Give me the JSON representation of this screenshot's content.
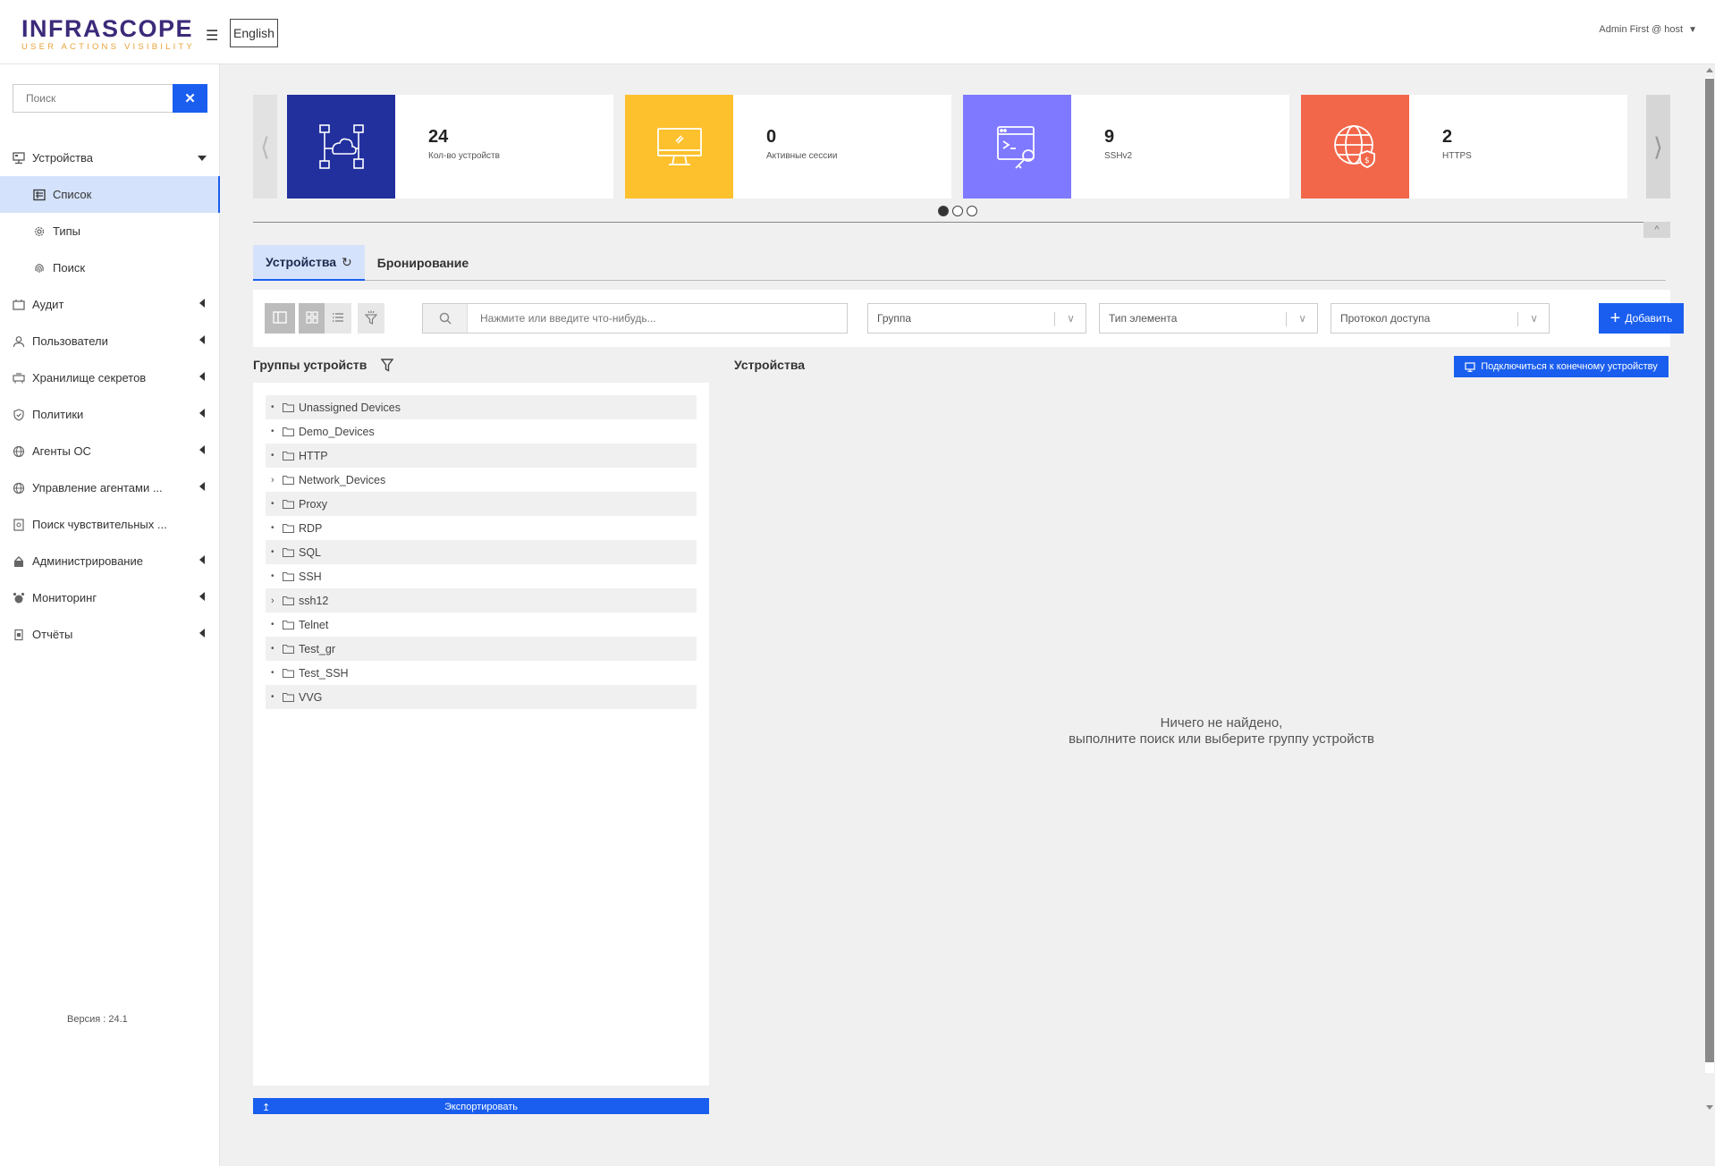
{
  "header": {
    "logo_main": "INFRASCOPE",
    "logo_sub": "USER ACTIONS VISIBILITY",
    "language": "English",
    "user": "Admin First @ host",
    "menu_icon": "hamburger-icon"
  },
  "sidebar": {
    "search_placeholder": "Поиск",
    "clear_icon": "close-icon",
    "items": [
      {
        "label": "Устройства",
        "icon": "devices-icon",
        "expanded": true
      },
      {
        "label": "Список",
        "icon": "list-icon",
        "active": true
      },
      {
        "label": "Типы",
        "icon": "gear-icon"
      },
      {
        "label": "Поиск",
        "icon": "fingerprint-icon"
      },
      {
        "label": "Аудит",
        "icon": "audit-icon"
      },
      {
        "label": "Пользователи",
        "icon": "user-icon"
      },
      {
        "label": "Хранилище секретов",
        "icon": "vault-icon"
      },
      {
        "label": "Политики",
        "icon": "shield-icon"
      },
      {
        "label": "Агенты ОС",
        "icon": "globe-icon"
      },
      {
        "label": "Управление агентами ...",
        "icon": "globe-icon"
      },
      {
        "label": "Поиск чувствительных ...",
        "icon": "document-search-icon"
      },
      {
        "label": "Администрирование",
        "icon": "admin-icon"
      },
      {
        "label": "Мониторинг",
        "icon": "alarm-icon"
      },
      {
        "label": "Отчёты",
        "icon": "report-icon"
      }
    ],
    "version": "Версия : 24.1"
  },
  "stats": [
    {
      "value": "24",
      "label": "Кол-во устройств",
      "color": "#22309e",
      "icon": "network-devices-icon"
    },
    {
      "value": "0",
      "label": "Активные сессии",
      "color": "#fdc12e",
      "icon": "monitor-icon"
    },
    {
      "value": "9",
      "label": "SSHv2",
      "color": "#7e79ff",
      "icon": "terminal-key-icon"
    },
    {
      "value": "2",
      "label": "HTTPS",
      "color": "#f2674a",
      "icon": "globe-shield-icon"
    }
  ],
  "carousel": {
    "pages": 3,
    "current": 1
  },
  "tabs": [
    {
      "label": "Устройства",
      "active": true
    },
    {
      "label": "Бронирование",
      "active": false
    }
  ],
  "toolbar": {
    "search_placeholder": "Нажмите или введите что-нибудь...",
    "group_placeholder": "Группа",
    "type_placeholder": "Тип элемента",
    "protocol_placeholder": "Протокол доступа",
    "add_label": "Добавить"
  },
  "groups": {
    "title": "Группы устройств",
    "items": [
      {
        "name": "Unassigned Devices",
        "expandable": false
      },
      {
        "name": "Demo_Devices",
        "expandable": false
      },
      {
        "name": "HTTP",
        "expandable": false
      },
      {
        "name": "Network_Devices",
        "expandable": true
      },
      {
        "name": "Proxy",
        "expandable": false
      },
      {
        "name": "RDP",
        "expandable": false
      },
      {
        "name": "SQL",
        "expandable": false
      },
      {
        "name": "SSH",
        "expandable": false
      },
      {
        "name": "ssh12",
        "expandable": true
      },
      {
        "name": "Telnet",
        "expandable": false
      },
      {
        "name": "Test_gr",
        "expandable": false
      },
      {
        "name": "Test_SSH",
        "expandable": false
      },
      {
        "name": "VVG",
        "expandable": false
      }
    ],
    "export_label": "Экспортировать"
  },
  "devices": {
    "title": "Устройства",
    "connect_label": "Подключиться к конечному устройству",
    "empty_line1": "Ничего не найдено,",
    "empty_line2": "выполните поиск или выберите группу устройств"
  },
  "colors": {
    "accent": "#1a5eef",
    "active_bg": "#d5e2fb"
  }
}
